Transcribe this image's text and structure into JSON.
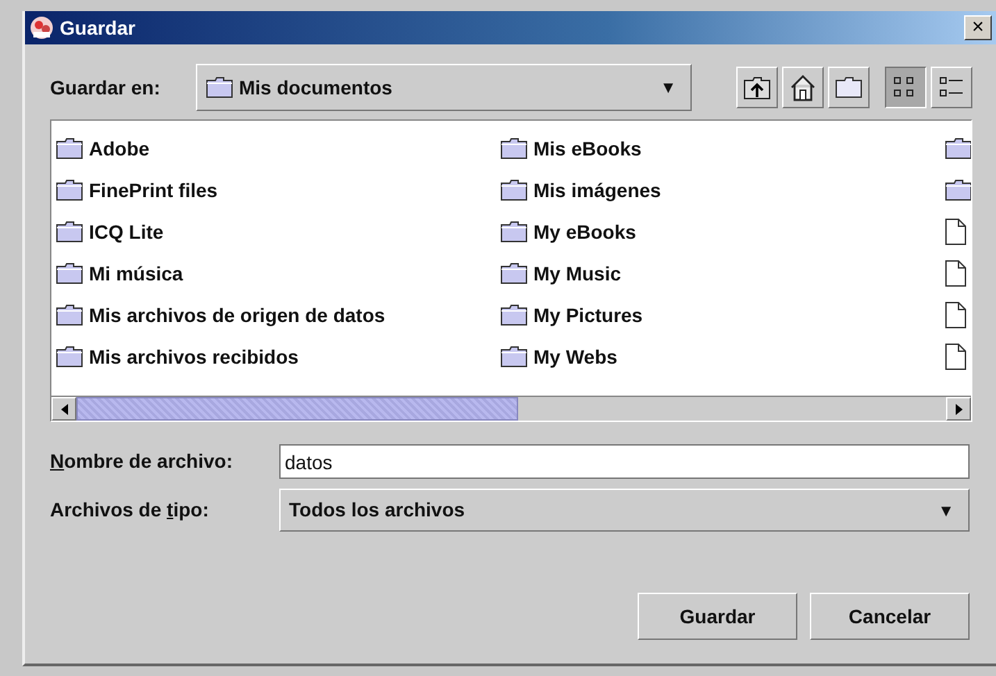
{
  "window": {
    "title": "Guardar",
    "close": "×"
  },
  "look_in": {
    "label": "Guardar en:",
    "value": "Mis documentos",
    "arrow": "▼"
  },
  "toolbar": [
    {
      "kind": "up",
      "selected": false
    },
    {
      "kind": "home",
      "selected": false
    },
    {
      "kind": "new-folder",
      "selected": false
    },
    {
      "kind": "list",
      "selected": true
    },
    {
      "kind": "details",
      "selected": false
    }
  ],
  "files": [
    {
      "kind": "folder",
      "label": "Adobe"
    },
    {
      "kind": "folder",
      "label": "FinePrint files"
    },
    {
      "kind": "folder",
      "label": "ICQ Lite"
    },
    {
      "kind": "folder",
      "label": "Mi música"
    },
    {
      "kind": "folder",
      "label": "Mis archivos de origen de datos"
    },
    {
      "kind": "folder",
      "label": "Mis archivos recibidos"
    },
    {
      "kind": "folder",
      "label": "Mis eBooks"
    },
    {
      "kind": "folder",
      "label": "Mis imágenes"
    },
    {
      "kind": "folder",
      "label": "My eBooks"
    },
    {
      "kind": "folder",
      "label": "My Music"
    },
    {
      "kind": "folder",
      "label": "My Pictures"
    },
    {
      "kind": "folder",
      "label": "My Webs"
    },
    {
      "kind": "folder"
    },
    {
      "kind": "folder"
    },
    {
      "kind": "file"
    },
    {
      "kind": "file"
    },
    {
      "kind": "file"
    },
    {
      "kind": "file"
    }
  ],
  "file_name": {
    "label": {
      "key": "N",
      "after": "ombre de archivo:"
    },
    "value": "datos"
  },
  "file_type": {
    "label": {
      "before": "Archivos de ",
      "key": "t",
      "after": "ipo:"
    },
    "value": "Todos los archivos",
    "arrow": "▼"
  },
  "buttons": [
    "Guardar",
    "Cancelar"
  ]
}
